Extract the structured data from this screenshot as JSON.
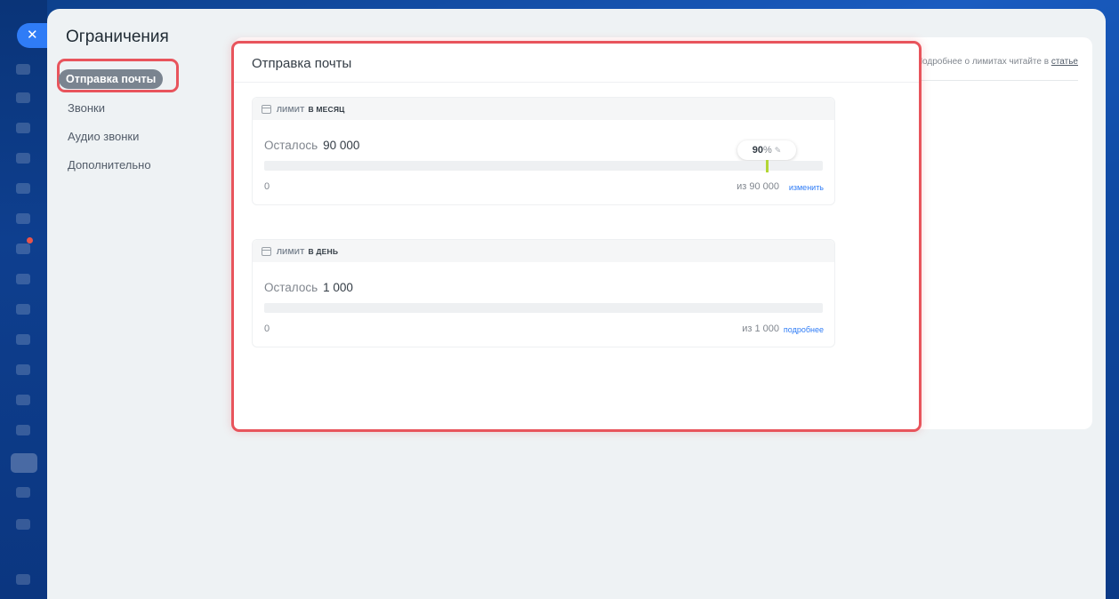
{
  "panel": {
    "title": "Ограничения"
  },
  "nav": {
    "items": [
      {
        "label": "Отправка почты",
        "active": true
      },
      {
        "label": "Звонки",
        "active": false
      },
      {
        "label": "Аудио звонки",
        "active": false
      },
      {
        "label": "Дополнительно",
        "active": false
      }
    ]
  },
  "article": {
    "text": "Подробнее о лимитах читайте в",
    "link": "статье"
  },
  "content": {
    "title": "Отправка почты",
    "limits": [
      {
        "head_prefix": "ЛИМИТ",
        "head_period": "В МЕСЯЦ",
        "remaining_label": "Осталось",
        "remaining_value": "90 000",
        "min": "0",
        "max": "из 90 000",
        "link": "изменить",
        "threshold_percent": 90,
        "threshold_label": "90",
        "threshold_unit": "%"
      },
      {
        "head_prefix": "ЛИМИТ",
        "head_period": "В ДЕНЬ",
        "remaining_label": "Осталось",
        "remaining_value": "1 000",
        "min": "0",
        "max": "из 1 000",
        "link": "подробнее"
      }
    ]
  },
  "colors": {
    "accent": "#2f7cf6",
    "highlight": "#e8545c",
    "threshold": "#b2d634"
  }
}
